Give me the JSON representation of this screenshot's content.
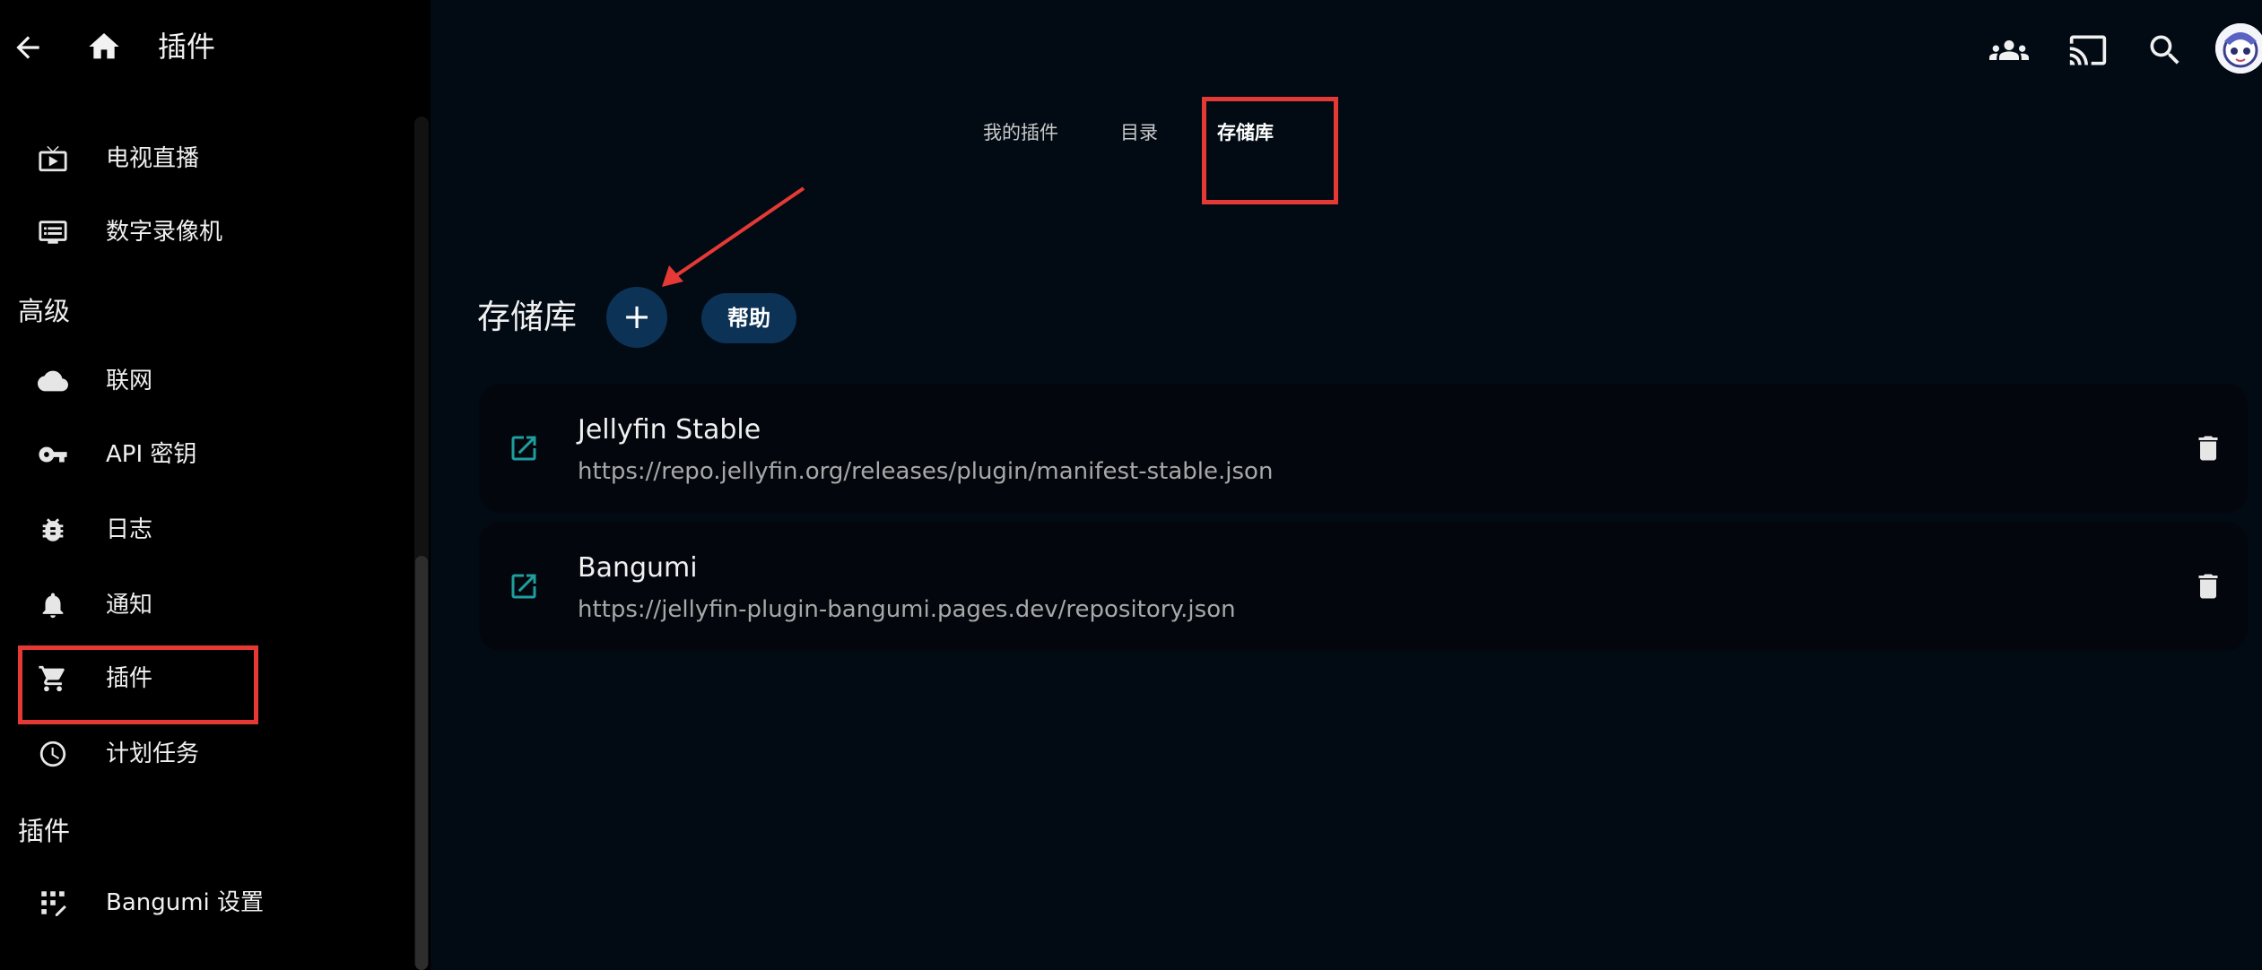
{
  "header": {
    "title": "插件",
    "back_icon": "arrow-left-icon",
    "home_icon": "home-icon"
  },
  "sidebar": {
    "items_top": [
      {
        "label": "电视直播",
        "icon": "live-tv-icon"
      },
      {
        "label": "数字录像机",
        "icon": "dvr-icon"
      }
    ],
    "section_advanced": "高级",
    "items_advanced": [
      {
        "label": "联网",
        "icon": "cloud-icon"
      },
      {
        "label": "API 密钥",
        "icon": "key-icon"
      },
      {
        "label": "日志",
        "icon": "bug-icon"
      },
      {
        "label": "通知",
        "icon": "bell-icon"
      },
      {
        "label": "插件",
        "icon": "cart-icon"
      },
      {
        "label": "计划任务",
        "icon": "clock-icon"
      }
    ],
    "section_plugins": "插件",
    "items_plugins": [
      {
        "label": "Bangumi 设置",
        "icon": "grid-settings-icon"
      }
    ]
  },
  "topbar": {
    "icons": [
      "users-icon",
      "cast-icon",
      "search-icon",
      "avatar"
    ]
  },
  "tabs": [
    {
      "label": "我的插件",
      "active": false
    },
    {
      "label": "目录",
      "active": false
    },
    {
      "label": "存储库",
      "active": true
    }
  ],
  "main": {
    "title": "存储库",
    "add_button_label": "+",
    "help_button_label": "帮助"
  },
  "repositories": [
    {
      "name": "Jellyfin Stable",
      "url": "https://repo.jellyfin.org/releases/plugin/manifest-stable.json"
    },
    {
      "name": "Bangumi",
      "url": "https://jellyfin-plugin-bangumi.pages.dev/repository.json"
    }
  ],
  "colors": {
    "background": "#020b14",
    "sidebar": "#000000",
    "accent_button": "#0c3256",
    "highlight": "#e53935",
    "link_icon": "#00a4dc"
  }
}
